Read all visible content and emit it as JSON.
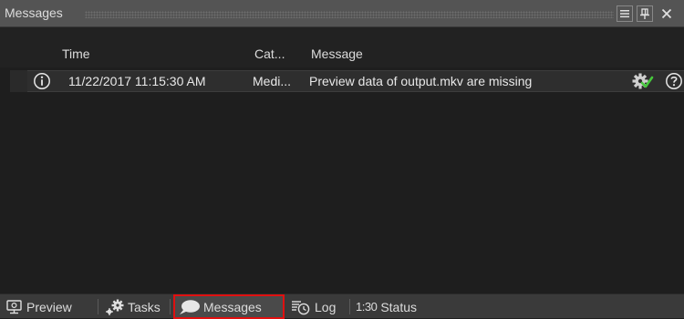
{
  "panel": {
    "title": "Messages"
  },
  "columns": {
    "time": "Time",
    "category": "Cat...",
    "message": "Message"
  },
  "rows": [
    {
      "icon": "info-icon",
      "time": "11/22/2017 11:15:30 AM",
      "category": "Medi...",
      "message": "Preview data of output.mkv are missing",
      "action_icon": "gear-check-icon",
      "help_icon": "help-icon"
    }
  ],
  "tabs": [
    {
      "label": "Preview",
      "icon": "preview-monitor-icon"
    },
    {
      "label": "Tasks",
      "icon": "tasks-gears-icon"
    },
    {
      "label": "Messages",
      "icon": "speech-bubble-icon",
      "active": true
    },
    {
      "label": "Log",
      "icon": "log-clock-icon"
    },
    {
      "label": "Status",
      "prefix": "1:30"
    }
  ],
  "colors": {
    "background": "#1e1e1e",
    "titlebar": "#545454",
    "active_tab_border": "#e01010",
    "check_green": "#46c83c"
  }
}
